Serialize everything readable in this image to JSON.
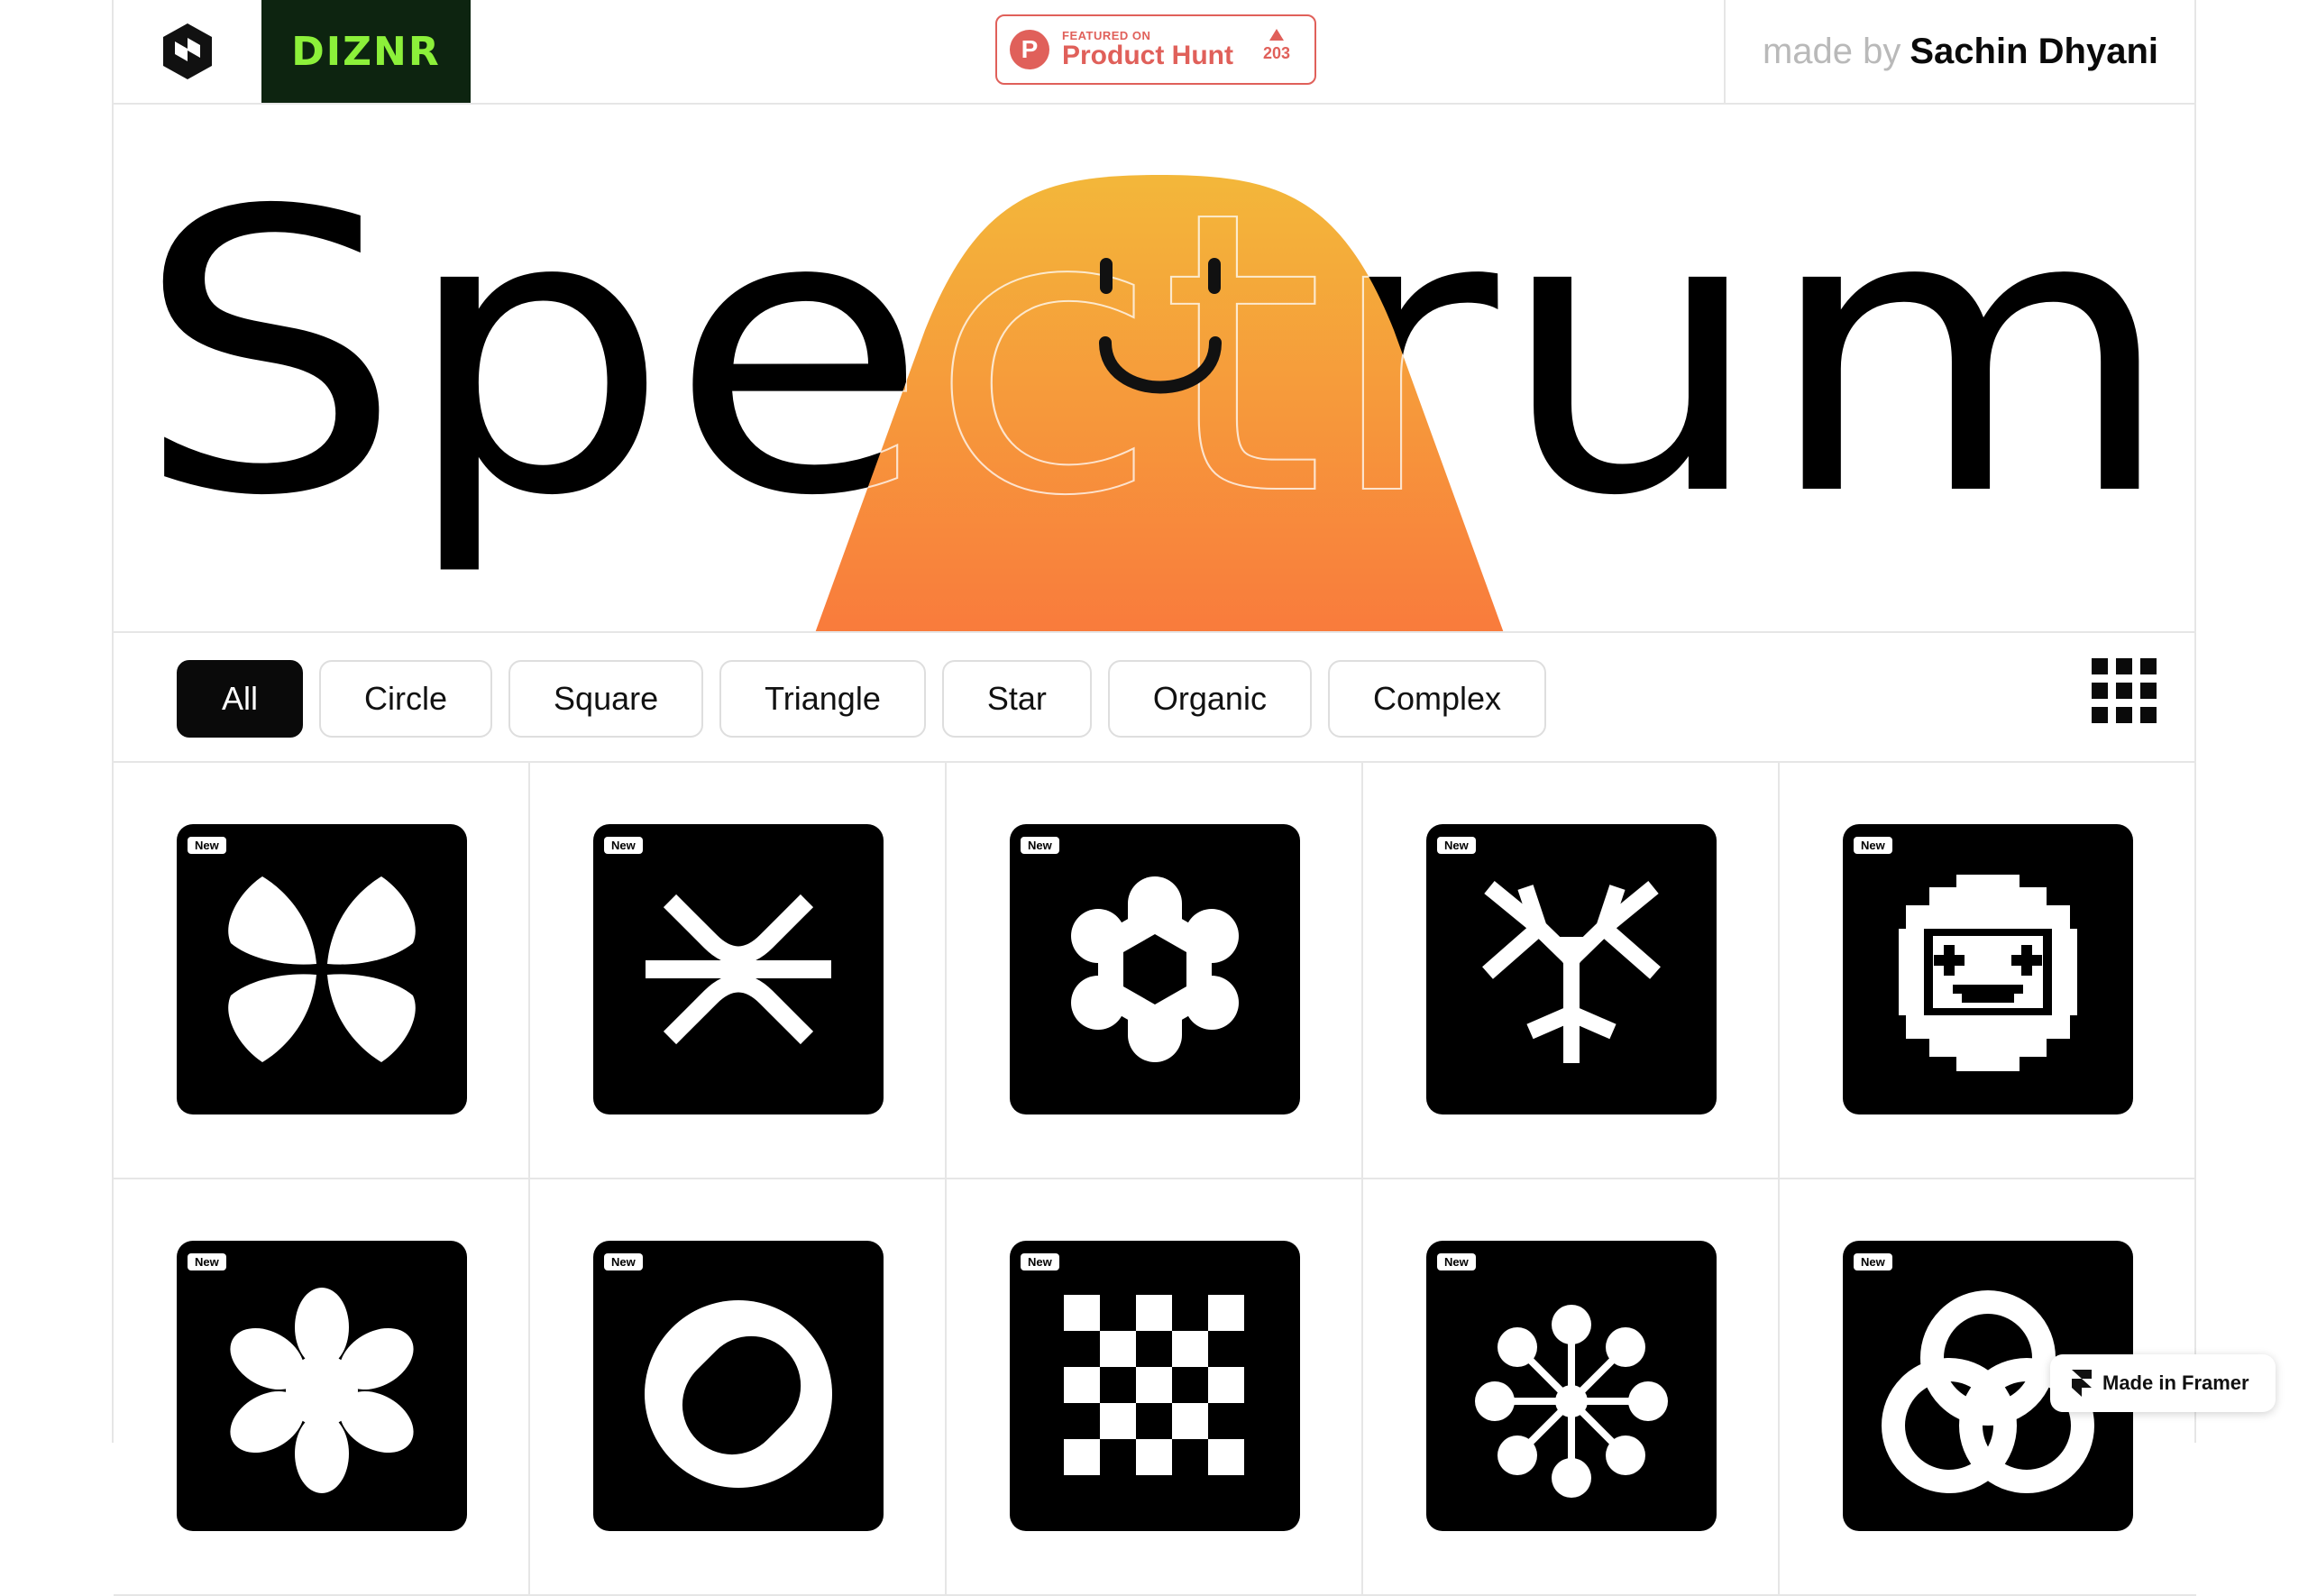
{
  "header": {
    "logo_icon": "dizainr-hex-logo-icon",
    "brand": "DIZNR",
    "product_hunt": {
      "small": "FEATURED ON",
      "big": "Product Hunt",
      "votes": "203",
      "letter": "P"
    },
    "maker_prefix": "made by",
    "maker_name": "Sachin Dhyani"
  },
  "hero": {
    "title": "Spectrum",
    "mascot": "orange-smiley-blob",
    "gradient_top": "#f3b73a",
    "gradient_bottom": "#f97b3c"
  },
  "filters": {
    "chips": [
      "All",
      "Circle",
      "Square",
      "Triangle",
      "Star",
      "Organic",
      "Complex"
    ],
    "active": "All",
    "view_toggle_icon": "grid-view-icon"
  },
  "shapes": [
    {
      "badge": "New",
      "icon": "four-petal-clover-icon"
    },
    {
      "badge": "New",
      "icon": "cross-arrows-icon"
    },
    {
      "badge": "New",
      "icon": "hex-flower-icon"
    },
    {
      "badge": "New",
      "icon": "branching-tri-star-icon"
    },
    {
      "badge": "New",
      "icon": "pixel-smiley-flower-icon"
    },
    {
      "badge": "New",
      "icon": "rounded-asterisk-icon"
    },
    {
      "badge": "New",
      "icon": "slanted-ring-icon"
    },
    {
      "badge": "New",
      "icon": "checker-stamp-icon"
    },
    {
      "badge": "New",
      "icon": "radial-dots-icon"
    },
    {
      "badge": "New",
      "icon": "interlocking-rings-icon"
    }
  ],
  "framer_badge": "Made in Framer"
}
